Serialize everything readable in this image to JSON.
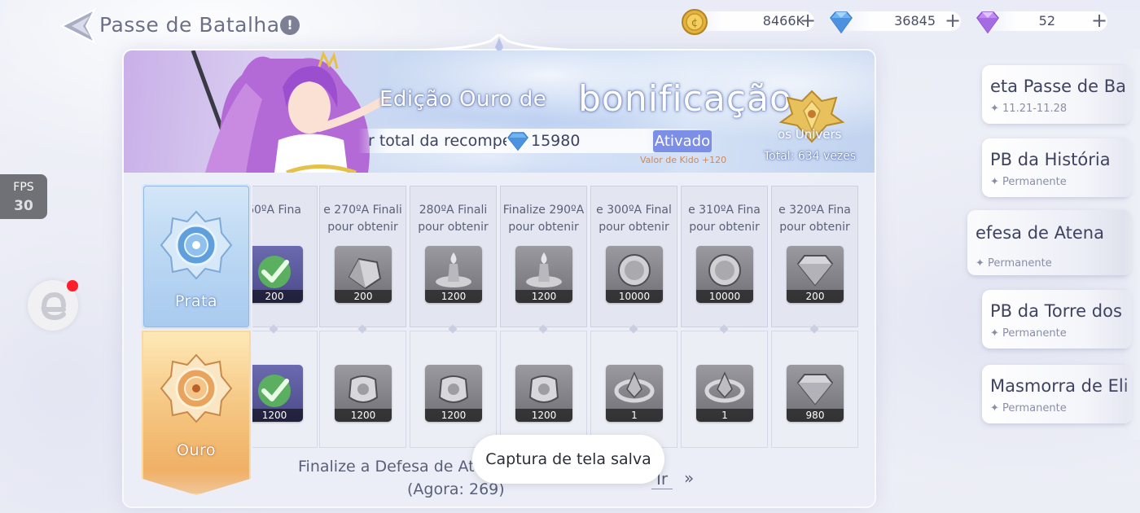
{
  "header": {
    "title": "Passe de Batalha",
    "info_icon": "!",
    "currencies": [
      {
        "name": "gold-coin",
        "value": "8466K",
        "plus": "+"
      },
      {
        "name": "blue-diamond",
        "value": "36845",
        "plus": "+"
      },
      {
        "name": "purple-diamond",
        "value": "52",
        "plus": "+"
      }
    ]
  },
  "banner": {
    "edition": "Edição Ouro de",
    "bonus": "bonificação",
    "reward_text": "r total da recompe",
    "reward_value": "15980",
    "activated": "Ativado",
    "kido": "Valor de Kido +120",
    "emblem_text": "os Univers",
    "total": "Total: 634 vezes"
  },
  "tiers": {
    "silver": "Prata",
    "gold": "Ouro"
  },
  "columns": [
    {
      "title_1": "60ºA  Fina",
      "title_2": "",
      "top_qty": "200",
      "bot_qty": "1200",
      "top_icon": "check-icon",
      "bot_icon": "check-icon"
    },
    {
      "title_1": "e 270ºA  Finali",
      "title_2": "pour obtenir",
      "top_qty": "200",
      "bot_qty": "1200",
      "top_icon": "crystal-icon",
      "bot_icon": "armor-icon"
    },
    {
      "title_1": "280ºA  Finali",
      "title_2": "pour obtenir",
      "top_qty": "1200",
      "bot_qty": "1200",
      "top_icon": "pedestal-icon",
      "bot_icon": "armor-icon"
    },
    {
      "title_1": "Finalize 290ºA",
      "title_2": "pour obtenir",
      "top_qty": "1200",
      "bot_qty": "1200",
      "top_icon": "pedestal-icon",
      "bot_icon": "armor-icon"
    },
    {
      "title_1": "e 300ºA  Final",
      "title_2": "pour obtenir",
      "top_qty": "10000",
      "bot_qty": "1",
      "top_icon": "coin-icon",
      "bot_icon": "ring-icon"
    },
    {
      "title_1": "e 310ºA  Fina",
      "title_2": "pour obtenir",
      "top_qty": "10000",
      "bot_qty": "1",
      "top_icon": "coin-icon",
      "bot_icon": "ring-icon"
    },
    {
      "title_1": "e 320ºA  Fina",
      "title_2": "pour obtenir",
      "top_qty": "200",
      "bot_qty": "980",
      "top_icon": "gem-icon",
      "bot_icon": "gem-icon"
    }
  ],
  "footer": {
    "task": "Finalize a Defesa de At",
    "now": "(Agora: 269)",
    "go": "Ir",
    "go_arrow": "»"
  },
  "toast": "Captura de tela salva",
  "overlay": {
    "fps_label": "FPS",
    "fps_value": "30"
  },
  "side_list": [
    {
      "name": "eta   Passe de Ba",
      "sub": "✦ 11.21-11.28"
    },
    {
      "name": "PB da História",
      "sub": "✦ Permanente"
    },
    {
      "name": "efesa de Atena",
      "sub": "✦ Permanente"
    },
    {
      "name": "PB da Torre dos",
      "sub": "✦ Permanente"
    },
    {
      "name": "Masmorra de Eli",
      "sub": "✦ Permanente"
    }
  ]
}
